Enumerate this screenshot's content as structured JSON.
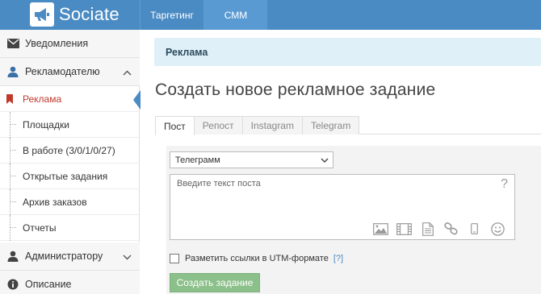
{
  "app": {
    "logo_text": "Sociate"
  },
  "topnav": {
    "items": [
      "Таргетинг",
      "СММ"
    ]
  },
  "sidebar": {
    "notifications": "Уведомления",
    "advertiser": "Рекламодателю",
    "sub_items": [
      "Реклама",
      "Площадки",
      "В работе (3/0/1/0/27)",
      "Открытые задания",
      "Архив заказов",
      "Отчеты"
    ],
    "admin": "Администратору",
    "description": "Описание"
  },
  "main": {
    "breadcrumb": "Реклама",
    "title": "Создать новое рекламное задание",
    "tabs": [
      "Пост",
      "Репост",
      "Instagram",
      "Telegram"
    ],
    "form": {
      "select_value": "Телеграмм",
      "text_placeholder": "Введите текст поста",
      "question_mark": "?",
      "utm_label": "Разметить ссылки в UTM-формате",
      "help_link": "[?]",
      "submit": "Создать задание"
    }
  },
  "colors": {
    "topbar": "#4a8bc4",
    "active": "#c0392b",
    "submit": "#8cc08a",
    "breadcrumb_bg": "#dff0f8"
  }
}
